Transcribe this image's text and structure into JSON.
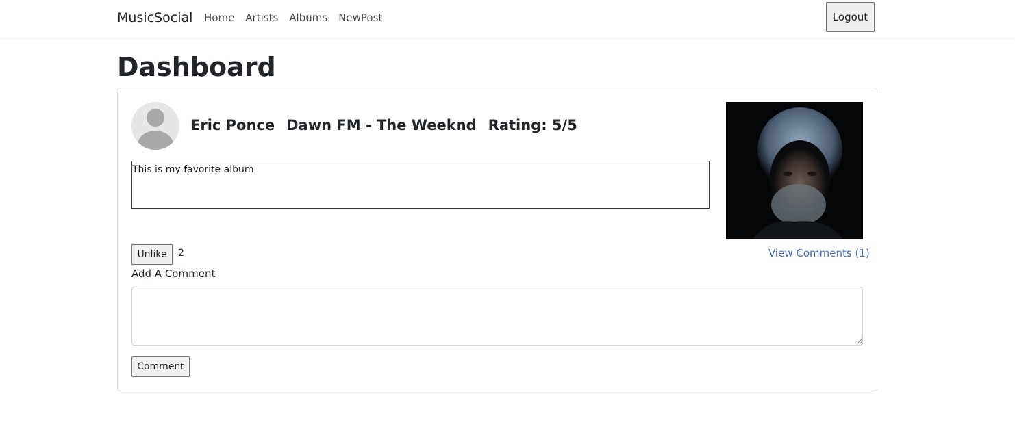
{
  "navbar": {
    "brand": "MusicSocial",
    "links": [
      {
        "label": "Home"
      },
      {
        "label": "Artists"
      },
      {
        "label": "Albums"
      },
      {
        "label": "NewPost"
      }
    ],
    "logout_label": "Logout"
  },
  "page": {
    "title": "Dashboard"
  },
  "post": {
    "author": "Eric Ponce",
    "album": "Dawn FM - The Weeknd",
    "rating": "Rating: 5/5",
    "text": "This is my favorite album",
    "album_art_icon": "album-cover-image",
    "avatar_icon": "default-user-avatar-icon",
    "unlike_label": "Unlike",
    "like_count": "2",
    "view_comments_label": "View Comments (1)",
    "add_comment_label": "Add A Comment",
    "comment_value": "",
    "comment_button_label": "Comment"
  },
  "colors": {
    "link": "#4a6ec2",
    "text": "#212529",
    "border": "#dfdfdf"
  }
}
